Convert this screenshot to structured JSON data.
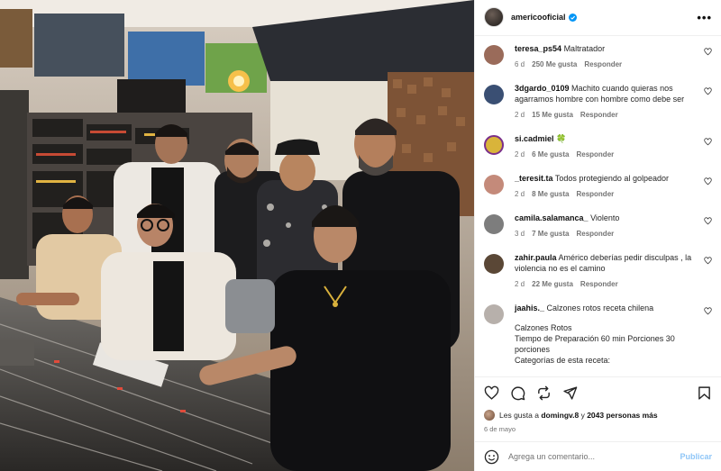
{
  "post": {
    "username": "americooficial",
    "verified": true,
    "more_label": "•••"
  },
  "comments": [
    {
      "user": "teresa_ps54",
      "text": "Maltratador",
      "age": "6 d",
      "likes": "250 Me gusta",
      "reply": "Responder",
      "avatar_color": "#9a6b5a"
    },
    {
      "user": "3dgardo_0109",
      "text": "Machito cuando quieras nos agarramos hombre con hombre como debe ser",
      "age": "2 d",
      "likes": "15 Me gusta",
      "reply": "Responder",
      "avatar_color": "#3a4f73"
    },
    {
      "user": "si.cadmiel",
      "text": "",
      "badge": "🍀",
      "age": "2 d",
      "likes": "6 Me gusta",
      "reply": "Responder",
      "avatar_color": "#d9b43a"
    },
    {
      "user": "_teresit.ta",
      "text": "Todos protegiendo al golpeador",
      "age": "2 d",
      "likes": "8 Me gusta",
      "reply": "Responder",
      "avatar_color": "#c48a7a"
    },
    {
      "user": "camila.salamanca_",
      "text": "Violento",
      "age": "3 d",
      "likes": "7 Me gusta",
      "reply": "Responder",
      "avatar_color": "#7d7d7d"
    },
    {
      "user": "zahir.paula",
      "text": "Américo deberías pedir disculpas , la violencia no es el camino",
      "age": "2 d",
      "likes": "22 Me gusta",
      "reply": "Responder",
      "avatar_color": "#5a4736"
    },
    {
      "user": "jaahis._",
      "text": "Calzones rotos receta chilena",
      "age": "",
      "likes": "",
      "reply": "",
      "avatar_color": "#b7b0ab",
      "recipe": [
        "Calzones Rotos",
        "Tiempo de Preparación 60 min Porciones 30 porciones",
        "Categorías de esta receta:"
      ]
    }
  ],
  "actions": {
    "like_icon": "heart-icon",
    "comment_icon": "comment-icon",
    "share_icon": "repost-icon",
    "send_icon": "send-icon",
    "save_icon": "bookmark-icon"
  },
  "likes_summary": {
    "prefix": "Les gusta a ",
    "user": "domingv.8",
    "middle": " y ",
    "others": "2043 personas más"
  },
  "date": "6 de mayo",
  "composer": {
    "placeholder": "Agrega un comentario...",
    "publish_label": "Publicar"
  },
  "colors": {
    "verified": "#0095f6",
    "publish": "#8fc6f7",
    "muted": "#737373"
  }
}
